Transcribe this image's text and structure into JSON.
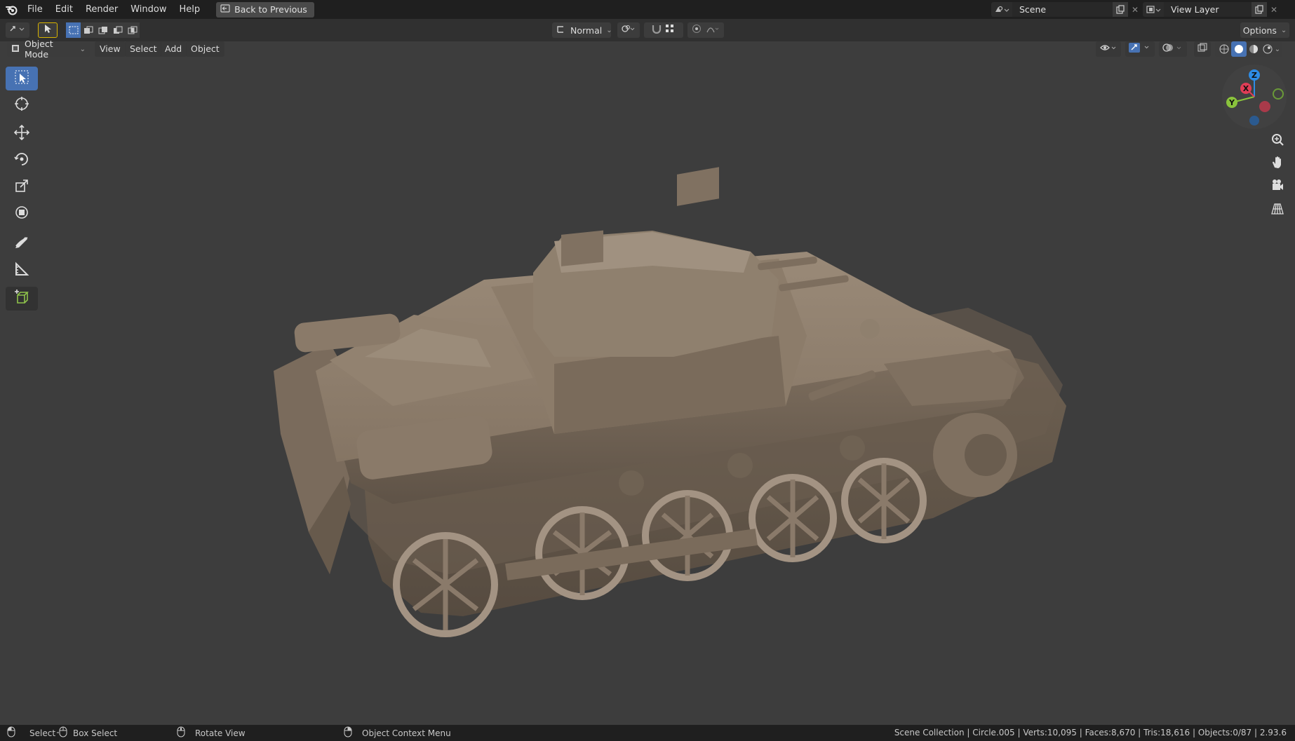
{
  "menubar": {
    "items": [
      "File",
      "Edit",
      "Render",
      "Window",
      "Help"
    ],
    "back_label": "Back to Previous",
    "scene_label": "Scene",
    "view_layer_label": "View Layer"
  },
  "header": {
    "orientation_label": "Normal",
    "options_label": "Options"
  },
  "viewport_menu": {
    "mode_label": "Object Mode",
    "items": [
      "View",
      "Select",
      "Add",
      "Object"
    ]
  },
  "gizmo": {
    "z_label": "Z",
    "y_label": "Y",
    "x_label": "X",
    "colors": {
      "x": "#e13d56",
      "y": "#8ac33c",
      "z": "#2d8ce6"
    }
  },
  "statusbar": {
    "select_label": "Select",
    "box_select_label": "Box Select",
    "rotate_label": "Rotate View",
    "context_menu_label": "Object Context Menu",
    "stats": "Scene Collection | Circle.005 | Verts:10,095 | Faces:8,670 | Tris:18,616 | Objects:0/87 | 2.93.6"
  },
  "colors": {
    "accent": "#4772b3",
    "model": "#857564",
    "viewport_bg": "#3d3d3d"
  }
}
